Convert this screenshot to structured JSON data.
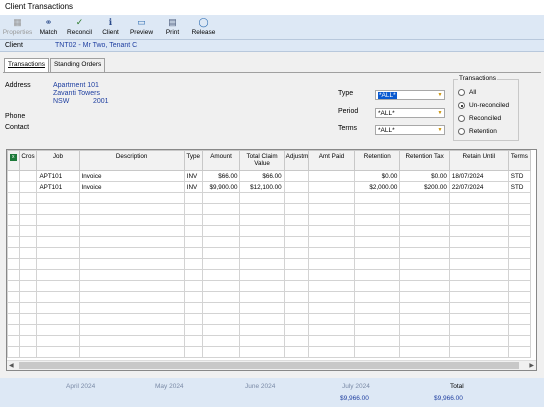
{
  "window": {
    "title": "Client Transactions"
  },
  "toolbar": {
    "properties": "Properties",
    "match": "Match",
    "reconcile": "Reconcil",
    "client": "Client",
    "preview": "Preview",
    "print": "Print",
    "release": "Release"
  },
  "client_row": {
    "label": "Client",
    "value": "TNT02 - Mr Two, Tenant C"
  },
  "tabs": {
    "transactions": "Transactions",
    "standing_orders": "Standing Orders"
  },
  "details": {
    "address_label": "Address",
    "address_line1": "Apartment 101",
    "address_line2": "Zavanti Towers",
    "address_state": "NSW",
    "address_postcode": "2001",
    "phone_label": "Phone",
    "contact_label": "Contact"
  },
  "filters": {
    "type_label": "Type",
    "type_value": "*ALL*",
    "period_label": "Period",
    "period_value": "*ALL*",
    "terms_label": "Terms",
    "terms_value": "*ALL*"
  },
  "transactions_group": {
    "title": "Transactions",
    "options": [
      "All",
      "Un-reconciled",
      "Reconciled",
      "Retention"
    ],
    "selected": "Un-reconciled"
  },
  "grid": {
    "columns": [
      "Cros",
      "Job",
      "Description",
      "Type",
      "Amount",
      "Total Claim Value",
      "Adjustm",
      "Amt Paid",
      "Retention",
      "Retention Tax",
      "Retain Until",
      "Terms"
    ],
    "rows": [
      [
        "",
        "APT101",
        "Invoice",
        "INV",
        "$66.00",
        "$66.00",
        "",
        "",
        "$0.00",
        "$0.00",
        "18/07/2024",
        "STD"
      ],
      [
        "",
        "APT101",
        "Invoice",
        "INV",
        "$9,900.00",
        "$12,100.00",
        "",
        "",
        "$2,000.00",
        "$200.00",
        "22/07/2024",
        "STD"
      ]
    ]
  },
  "totals": {
    "months": [
      "April 2024",
      "May 2024",
      "June 2024",
      "July 2024"
    ],
    "july_value": "$9,966.00",
    "total_label": "Total",
    "total_value": "$9,966.00"
  }
}
